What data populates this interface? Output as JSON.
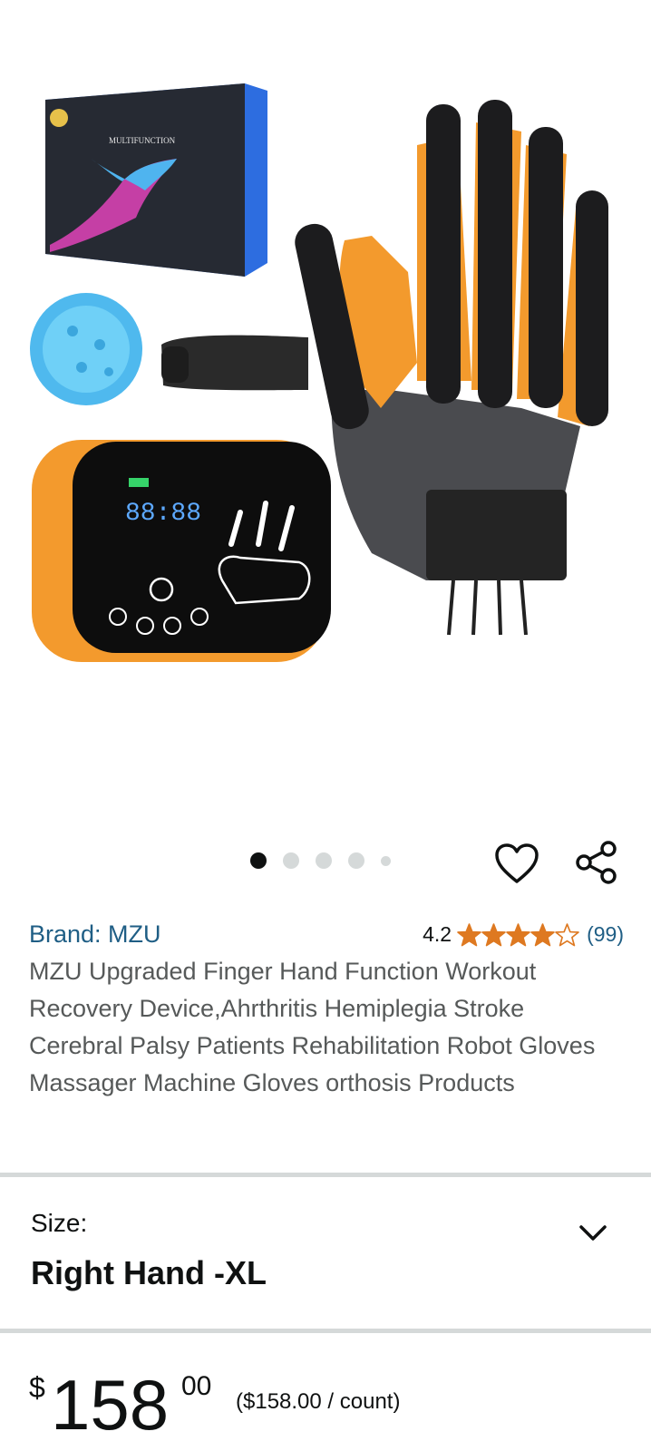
{
  "carousel": {
    "total": 5,
    "active_index": 0
  },
  "product": {
    "brand_label": "Brand: MZU",
    "rating_value": "4.2",
    "rating_stars": 4.2,
    "rating_count": "(99)",
    "title": "MZU Upgraded Finger Hand Function Workout Recovery Device,Ahrthritis Hemiplegia Stroke Cerebral Palsy Patients Rehabilitation Robot Gloves Massager Machine Gloves orthosis Products",
    "box_text": "MULTIFUNCTION",
    "device_display": "88:88"
  },
  "size": {
    "label": "Size:",
    "value": "Right Hand -XL"
  },
  "price": {
    "symbol": "$",
    "whole": "158",
    "fraction": "00",
    "per_unit": "($158.00 / count)"
  },
  "colors": {
    "link": "#1f5e85",
    "star": "#de7921",
    "text": "#0f1111",
    "muted": "#565959",
    "divider": "#d5d9d9",
    "glove_orange": "#f39a2d"
  },
  "icons": {
    "wishlist": "heart-outline-icon",
    "share": "share-icon",
    "dropdown": "chevron-down-icon",
    "star": "star-icon"
  }
}
